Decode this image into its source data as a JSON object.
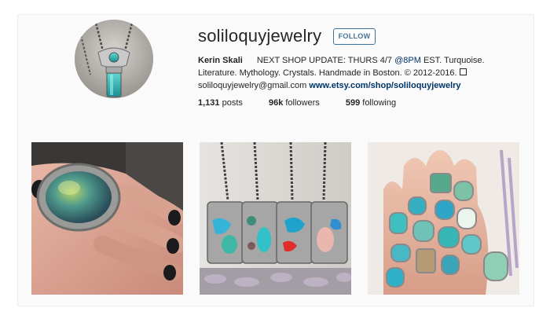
{
  "profile": {
    "username": "soliloquyjewelry",
    "follow_label": "FOLLOW",
    "display_name": "Kerin Skali",
    "bio_text1": "NEXT SHOP UPDATE: THURS 4/7 ",
    "bio_time": "@8PM",
    "bio_text2": " EST. Turquoise. Literature. Mythology. Crystals. Handmade in Boston. © 2012-2016.",
    "email": "soliloquyjewelry@gmail.com",
    "website": "www.etsy.com/shop/soliloquyjewelry",
    "accent_color": "#3f729b",
    "link_color": "#003569"
  },
  "stats": {
    "posts_count": "1,131",
    "posts_label": " posts",
    "followers_count": "96k",
    "followers_label": " followers",
    "following_count": "599",
    "following_label": " following"
  },
  "posts": [
    {
      "description_icon": "labradorite-ring-photo"
    },
    {
      "description_icon": "turquoise-pendants-photo"
    },
    {
      "description_icon": "stacked-rings-photo"
    }
  ]
}
